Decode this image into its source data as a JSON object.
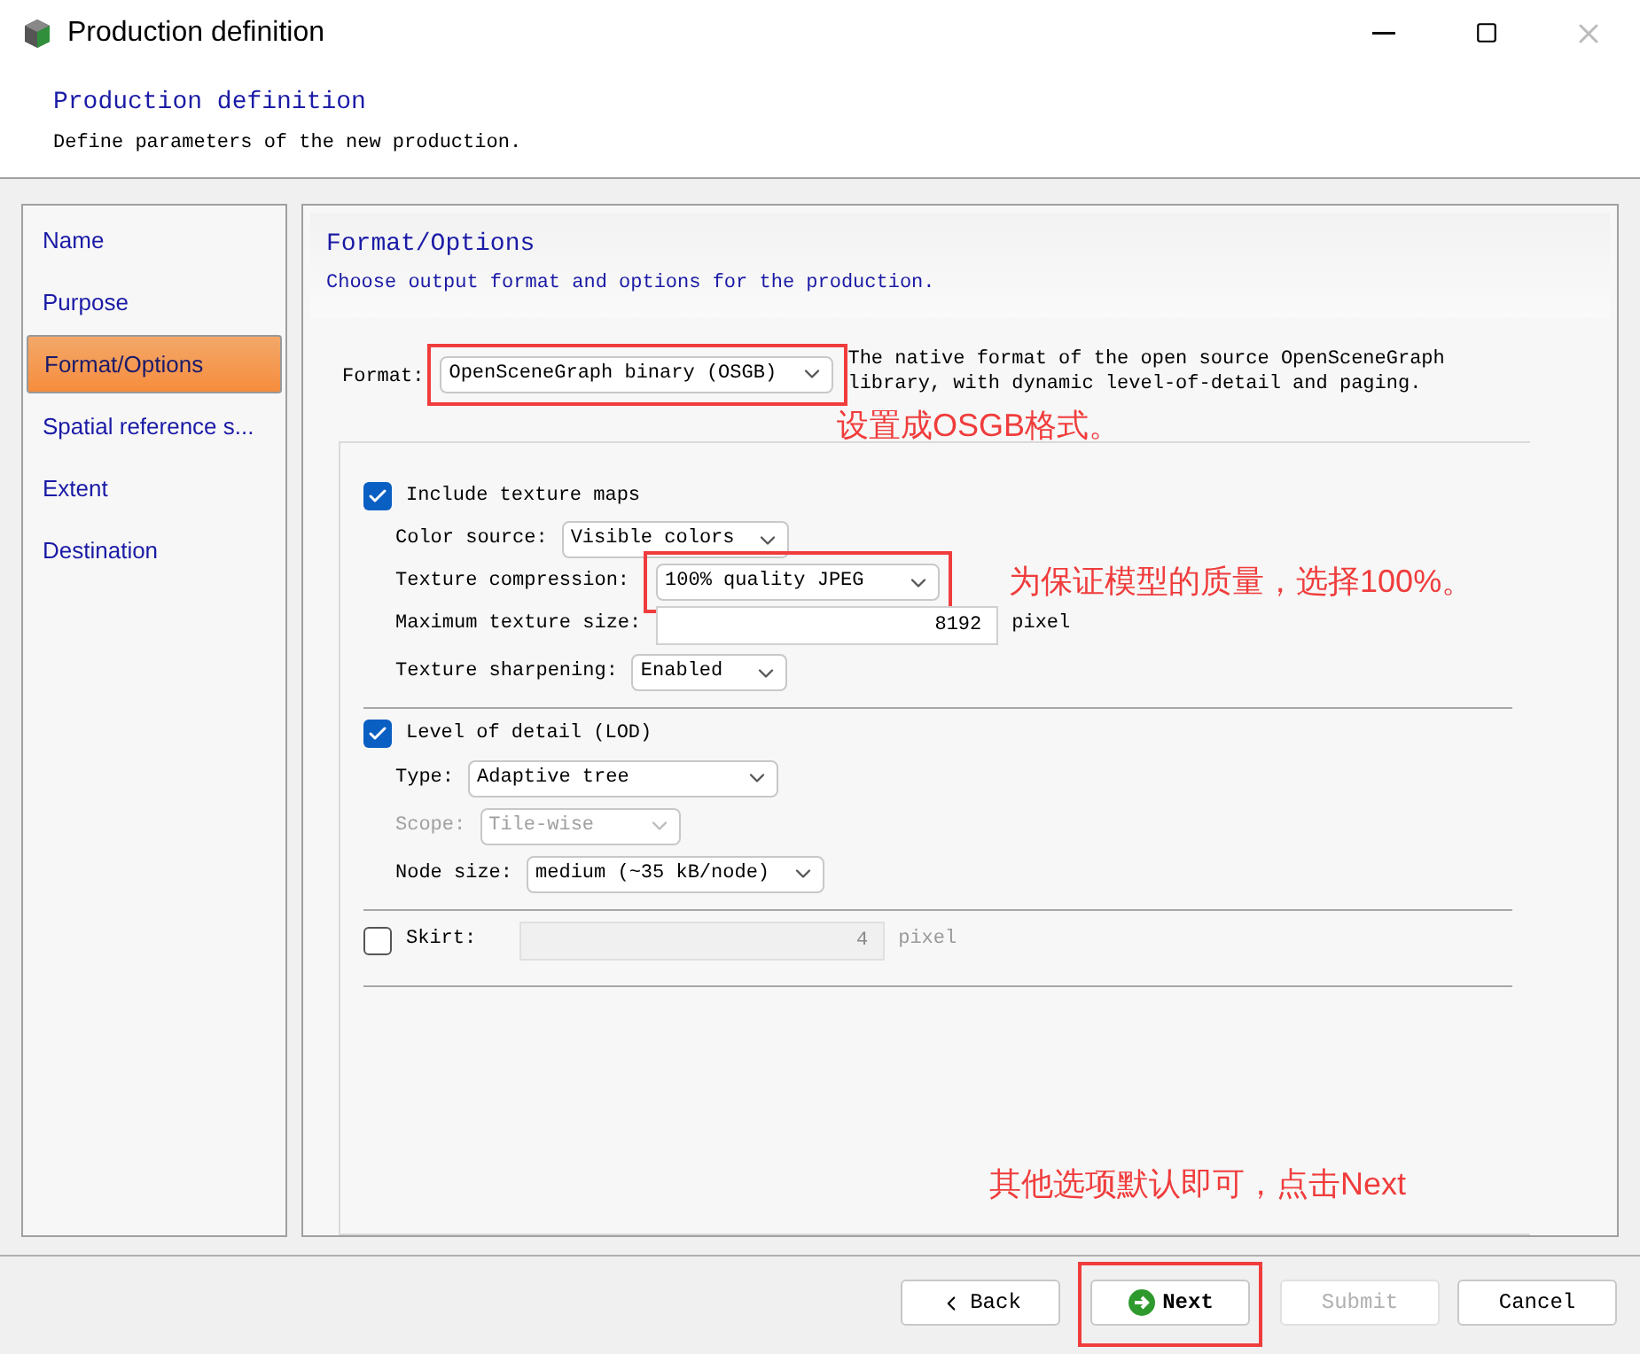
{
  "window": {
    "title": "Production definition"
  },
  "header": {
    "title": "Production definition",
    "subtitle": "Define parameters of the new production."
  },
  "sidebar": {
    "items": [
      {
        "label": "Name",
        "selected": false
      },
      {
        "label": "Purpose",
        "selected": false
      },
      {
        "label": "Format/Options",
        "selected": true
      },
      {
        "label": "Spatial reference s...",
        "selected": false
      },
      {
        "label": "Extent",
        "selected": false
      },
      {
        "label": "Destination",
        "selected": false
      }
    ]
  },
  "page": {
    "title": "Format/Options",
    "subtitle": "Choose output format and options for the production."
  },
  "format": {
    "label": "Format:",
    "value": "OpenSceneGraph binary (OSGB)",
    "highlighted": true,
    "description": "The native format of the open source OpenSceneGraph library, with dynamic level-of-detail and paging.",
    "annotation": "设置成OSGB格式。"
  },
  "sections": [
    {
      "label": "Include texture maps",
      "checked": true,
      "rows": [
        {
          "kind": "select",
          "label": "Color source:",
          "value": "Visible colors",
          "disabled": false,
          "highlighted": false
        },
        {
          "kind": "select",
          "label": "Texture compression:",
          "value": "100% quality JPEG",
          "disabled": false,
          "highlighted": true,
          "annotation": "为保证模型的质量，选择100%。"
        },
        {
          "kind": "input",
          "label": "Maximum texture size:",
          "value": "8192",
          "unit": "pixel",
          "disabled": false,
          "highlighted": false
        },
        {
          "kind": "select",
          "label": "Texture sharpening:",
          "value": "Enabled",
          "disabled": false,
          "highlighted": false
        }
      ]
    },
    {
      "label": "Level of detail (LOD)",
      "checked": true,
      "rows": [
        {
          "kind": "select",
          "label": "Type:",
          "value": "Adaptive tree",
          "disabled": false,
          "highlighted": false
        },
        {
          "kind": "select",
          "label": "Scope:",
          "value": "Tile-wise",
          "disabled": true,
          "highlighted": false
        },
        {
          "kind": "select",
          "label": "Node size:",
          "value": "medium (~35 kB/node)",
          "disabled": false,
          "highlighted": false
        }
      ]
    },
    {
      "label": "Skirt:",
      "checked": false,
      "field": {
        "value": "4",
        "unit": "pixel",
        "disabled": true
      }
    }
  ],
  "footer_annotation": "其他选项默认即可，点击Next",
  "buttons": [
    {
      "kind": "back",
      "label": "Back",
      "disabled": false,
      "highlighted": false
    },
    {
      "kind": "next",
      "label": "Next",
      "disabled": false,
      "highlighted": true
    },
    {
      "kind": "plain",
      "label": "Submit",
      "disabled": true,
      "highlighted": false
    },
    {
      "kind": "plain",
      "label": "Cancel",
      "disabled": false,
      "highlighted": false
    }
  ]
}
